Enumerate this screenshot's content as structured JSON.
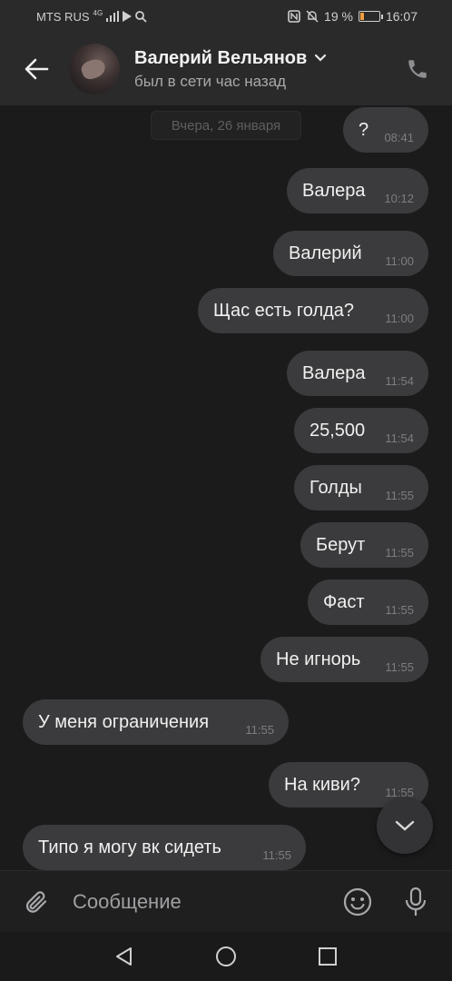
{
  "status_bar": {
    "carrier": "MTS RUS",
    "network": "4G",
    "battery_percent": "19 %",
    "battery_level": 0.19,
    "time": "16:07"
  },
  "header": {
    "name": "Валерий Вельянов",
    "status": "был в сети час назад"
  },
  "chat": {
    "date_separator": "Вчера, 26 января",
    "messages": [
      {
        "text": "?",
        "time": "08:41",
        "dir": "out"
      },
      {
        "text": "Валера",
        "time": "10:12",
        "dir": "out"
      },
      {
        "text": "Валерий",
        "time": "11:00",
        "dir": "out"
      },
      {
        "text": "Щас есть голда?",
        "time": "11:00",
        "dir": "out"
      },
      {
        "text": "Валера",
        "time": "11:54",
        "dir": "out"
      },
      {
        "text": "25,500",
        "time": "11:54",
        "dir": "out"
      },
      {
        "text": "Голды",
        "time": "11:55",
        "dir": "out"
      },
      {
        "text": "Берут",
        "time": "11:55",
        "dir": "out"
      },
      {
        "text": "Фаст",
        "time": "11:55",
        "dir": "out"
      },
      {
        "text": "Не игнорь",
        "time": "11:55",
        "dir": "out"
      },
      {
        "text": "У меня ограничения",
        "time": "11:55",
        "dir": "in"
      },
      {
        "text": "На киви?",
        "time": "11:55",
        "dir": "out"
      },
      {
        "text": "Типо я могу вк сидеть",
        "time": "11:55",
        "dir": "in"
      }
    ]
  },
  "composer": {
    "placeholder": "Сообщение",
    "value": ""
  },
  "icons": {
    "back": "arrow-left-icon",
    "dropdown": "chevron-down-icon",
    "call": "phone-icon",
    "scroll_down": "chevron-down-icon",
    "attach": "paperclip-icon",
    "emoji": "smiley-icon",
    "mic": "microphone-icon"
  },
  "colors": {
    "background": "#1b1b1c",
    "bar": "#2a2a2b",
    "bubble": "#3b3b3d",
    "battery": "#f0a040"
  }
}
